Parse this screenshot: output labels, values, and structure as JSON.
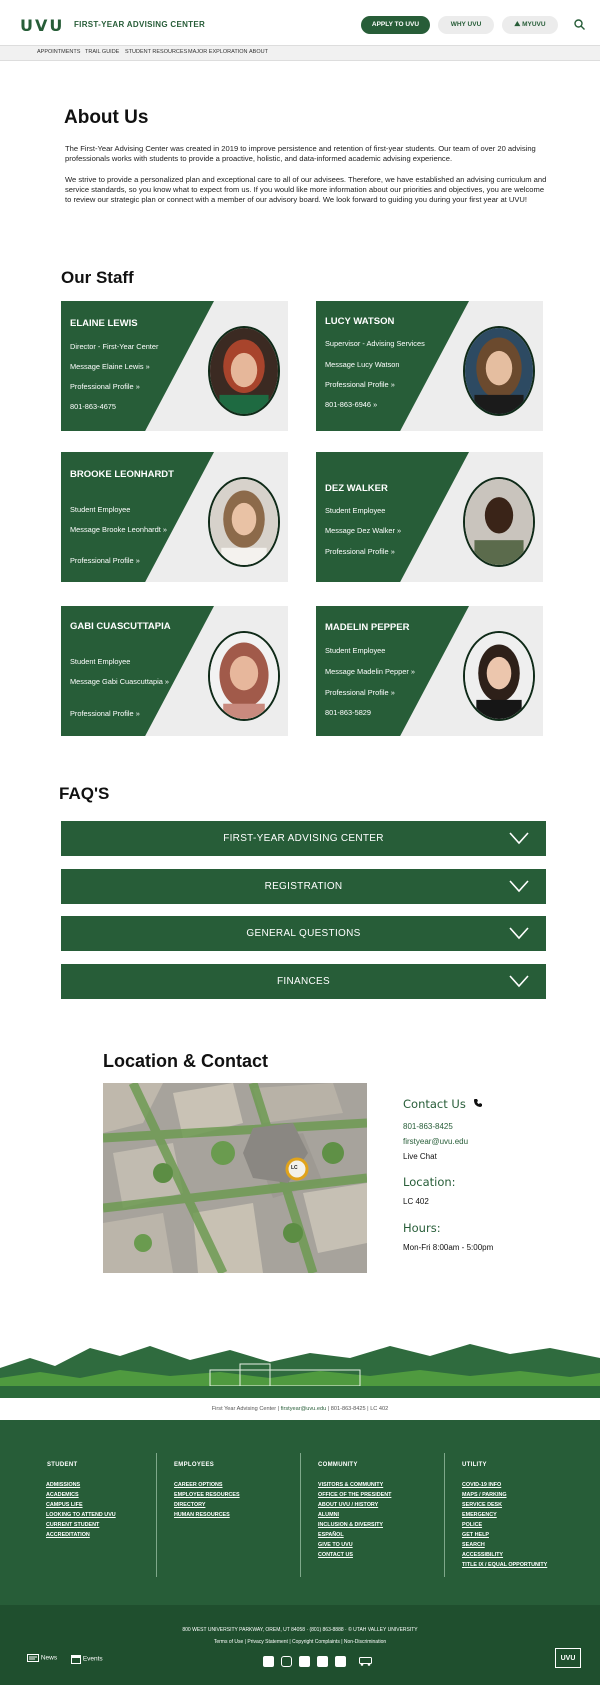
{
  "header": {
    "logo": "UVU",
    "site_title": "FIRST-YEAR ADVISING CENTER",
    "apply_label": "APPLY TO UVU",
    "why_label": "WHY UVU",
    "myuvu_label": "MYUVU"
  },
  "subnav": [
    "APPOINTMENTS",
    "TRAIL GUIDE",
    "STUDENT RESOURCES",
    "MAJOR EXPLORATION",
    "ABOUT"
  ],
  "about": {
    "title": "About Us",
    "p1": "The First-Year Advising Center was created in 2019 to improve persistence and retention of first-year students. Our team of over 20 advising professionals works with students to provide a proactive, holistic, and data-informed academic advising experience.",
    "p2": "We strive to provide a personalized plan and exceptional care to all of our advisees. Therefore, we have established an advising curriculum and service standards, so you know what to expect from us. If you would like more information about our priorities and objectives, you are welcome to review our strategic plan or connect with a member of our advisory board. We look forward to guiding you during your first year at UVU!"
  },
  "staff": {
    "title": "Our Staff",
    "cards": [
      {
        "name": "ELAINE LEWIS",
        "role": "Director - First-Year Center",
        "message": "Message Elaine Lewis »",
        "profile": "Professional Profile »",
        "phone": "801-863-4675"
      },
      {
        "name": "LUCY WATSON",
        "role": "Supervisor - Advising Services",
        "message": "Message Lucy Watson",
        "profile": "Professional Profile »",
        "phone": "801-863-6946  »"
      },
      {
        "name": "BROOKE LEONHARDT",
        "role": "Student Employee",
        "message": "Message Brooke Leonhardt »",
        "profile": "Professional Profile »",
        "phone": ""
      },
      {
        "name": "DEZ WALKER",
        "role": "Student Employee",
        "message": "Message Dez Walker  »",
        "profile": "Professional Profile  »",
        "phone": ""
      },
      {
        "name": "GABI CUASCUTTAPIA",
        "role": "Student Employee",
        "message": "Message Gabi Cuascuttapia »",
        "profile": "Professional Profile  »",
        "phone": ""
      },
      {
        "name": "MADELIN PEPPER",
        "role": "Student Employee",
        "message": "Message Madelin Pepper »",
        "profile": "Professional Profile »",
        "phone": "801-863-5829"
      }
    ]
  },
  "faq": {
    "title": "FAQ'S",
    "items": [
      "FIRST-YEAR ADVISING CENTER",
      "REGISTRATION",
      "GENERAL QUESTIONS",
      "FINANCES"
    ]
  },
  "location": {
    "title": "Location & Contact",
    "map_marker": "LC",
    "contact_heading": "Contact Us",
    "phone": "801-863-8425",
    "email": "firstyear@uvu.edu",
    "chat": "Live Chat",
    "location_heading": "Location:",
    "room": "LC 402",
    "hours_heading": "Hours:",
    "hours": "Mon-Fri 8:00am - 5:00pm"
  },
  "footer": {
    "strip_name": "First Year Advising Center",
    "strip_email": "firstyear@uvu.edu",
    "strip_phone": "801-863-8425",
    "strip_room": "LC 402",
    "columns": [
      {
        "heading": "STUDENT",
        "links": [
          "ADMISSIONS",
          "ACADEMICS",
          "CAMPUS LIFE",
          "LOOKING TO ATTEND UVU",
          "CURRENT STUDENT",
          "ACCREDITATION"
        ]
      },
      {
        "heading": "EMPLOYEES",
        "links": [
          "CAREER OPTIONS",
          "EMPLOYEE RESOURCES",
          "DIRECTORY",
          "HUMAN RESOURCES"
        ]
      },
      {
        "heading": "COMMUNITY",
        "links": [
          "VISITORS & COMMUNITY",
          "OFFICE OF THE PRESIDENT",
          "ABOUT UVU / HISTORY",
          "ALUMNI",
          "INCLUSION & DIVERSITY",
          "ESPAÑOL",
          "GIVE TO UVU",
          "CONTACT US"
        ]
      },
      {
        "heading": "UTILITY",
        "links": [
          "COVID-19 INFO",
          "MAPS / PARKING",
          "SERVICE DESK",
          "EMERGENCY",
          "POLICE",
          "GET HELP",
          "SEARCH",
          "ACCESSIBILITY",
          "TITLE IX / EQUAL OPPORTUNITY"
        ]
      }
    ],
    "address": "800 WEST UNIVERSITY PARKWAY, OREM, UT 84058  ·  (801) 863-8888  ·  © UTAH VALLEY UNIVERSITY",
    "legal": "Terms of Use  |  Privacy Statement  |  Copyright Complaints  |  Non-Discrimination",
    "news_label": "News",
    "events_label": "Events",
    "badge": "UVU"
  },
  "colors": {
    "brand_green": "#275d38",
    "footer_dark": "#1f4f2e"
  }
}
